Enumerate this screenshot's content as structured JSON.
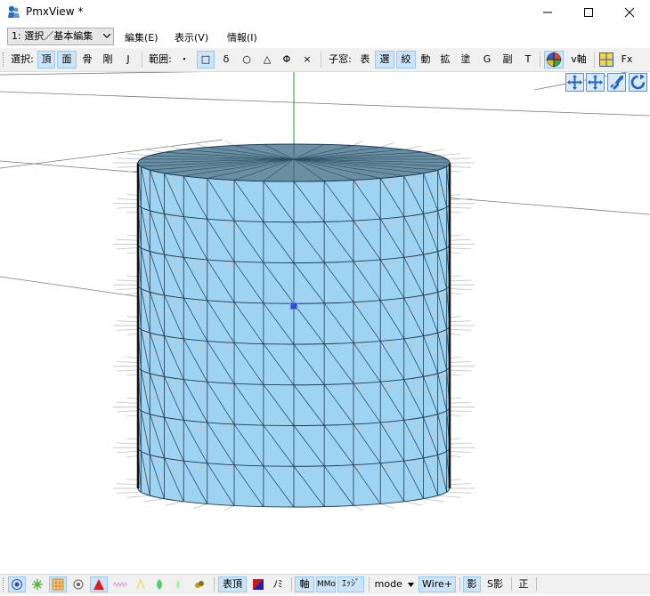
{
  "window": {
    "title": "PmxView *"
  },
  "menubar": {
    "mode_select": "1: 選択／基本編集",
    "items": [
      "編集(E)",
      "表示(V)",
      "情報(I)"
    ]
  },
  "toolbar": {
    "select_label": "選択:",
    "select_buttons": [
      "頂",
      "面",
      "骨",
      "剛",
      "J"
    ],
    "range_label": "範囲:",
    "range_buttons": [
      "・",
      "□",
      "δ",
      "○",
      "△",
      "Φ",
      "×"
    ],
    "child_label": "子窓:",
    "child_buttons": [
      "表",
      "選",
      "絞",
      "動",
      "拡",
      "塗",
      "G",
      "副",
      "T"
    ],
    "v_axis": "v軸",
    "fx": "Fx"
  },
  "statusbar": {
    "btn_surface_vertex": "表頂",
    "btn_mi": "ﾉﾐ",
    "btn_axis": "軸",
    "btn_mo": "MMo",
    "btn_edge": "ｴｯｼﾞ",
    "mode": "mode",
    "wire": "Wire+",
    "shadow": "影",
    "sshadow": "S影",
    "ortho": "正"
  },
  "colors": {
    "mesh_fill": "#9fd3f2",
    "mesh_top": "#6a8fa3",
    "accent_blue": "#1e64c8",
    "toolbar_bg": "#f0f0f0"
  }
}
